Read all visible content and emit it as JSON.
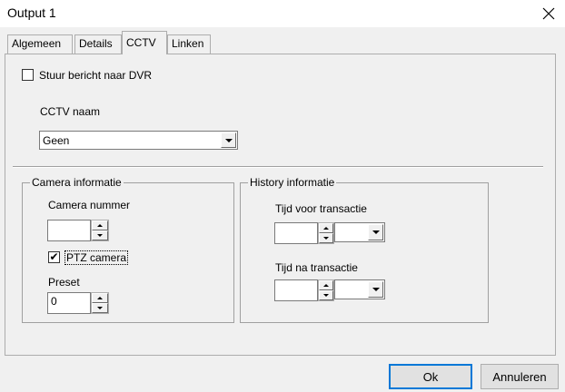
{
  "window": {
    "title": "Output 1"
  },
  "tabs": [
    {
      "label": "Algemeen"
    },
    {
      "label": "Details"
    },
    {
      "label": "CCTV"
    },
    {
      "label": "Linken"
    }
  ],
  "cctv": {
    "send_dvr_label": "Stuur bericht naar DVR",
    "send_dvr_checked": false,
    "cctv_name_label": "CCTV naam",
    "cctv_name_value": "Geen"
  },
  "camera": {
    "legend": "Camera informatie",
    "number_label": "Camera nummer",
    "number_value": "",
    "ptz_label": "PTZ camera",
    "ptz_checked": true,
    "ptz_check_glyph": "✔",
    "preset_label": "Preset",
    "preset_value": "0"
  },
  "history": {
    "legend": "History informatie",
    "before_label": "Tijd voor transactie",
    "before_value": "",
    "after_label": "Tijd na transactie",
    "after_value": ""
  },
  "buttons": {
    "ok": "Ok",
    "cancel": "Annuleren"
  },
  "icons": {
    "close": "close-icon",
    "dropdown": "chevron-down-icon",
    "spin_up": "arrow-up-icon",
    "spin_down": "arrow-down-icon"
  },
  "colors": {
    "dialog_bg": "#f0f0f0",
    "titlebar_bg": "#ffffff",
    "focus_border": "#0078d7"
  }
}
